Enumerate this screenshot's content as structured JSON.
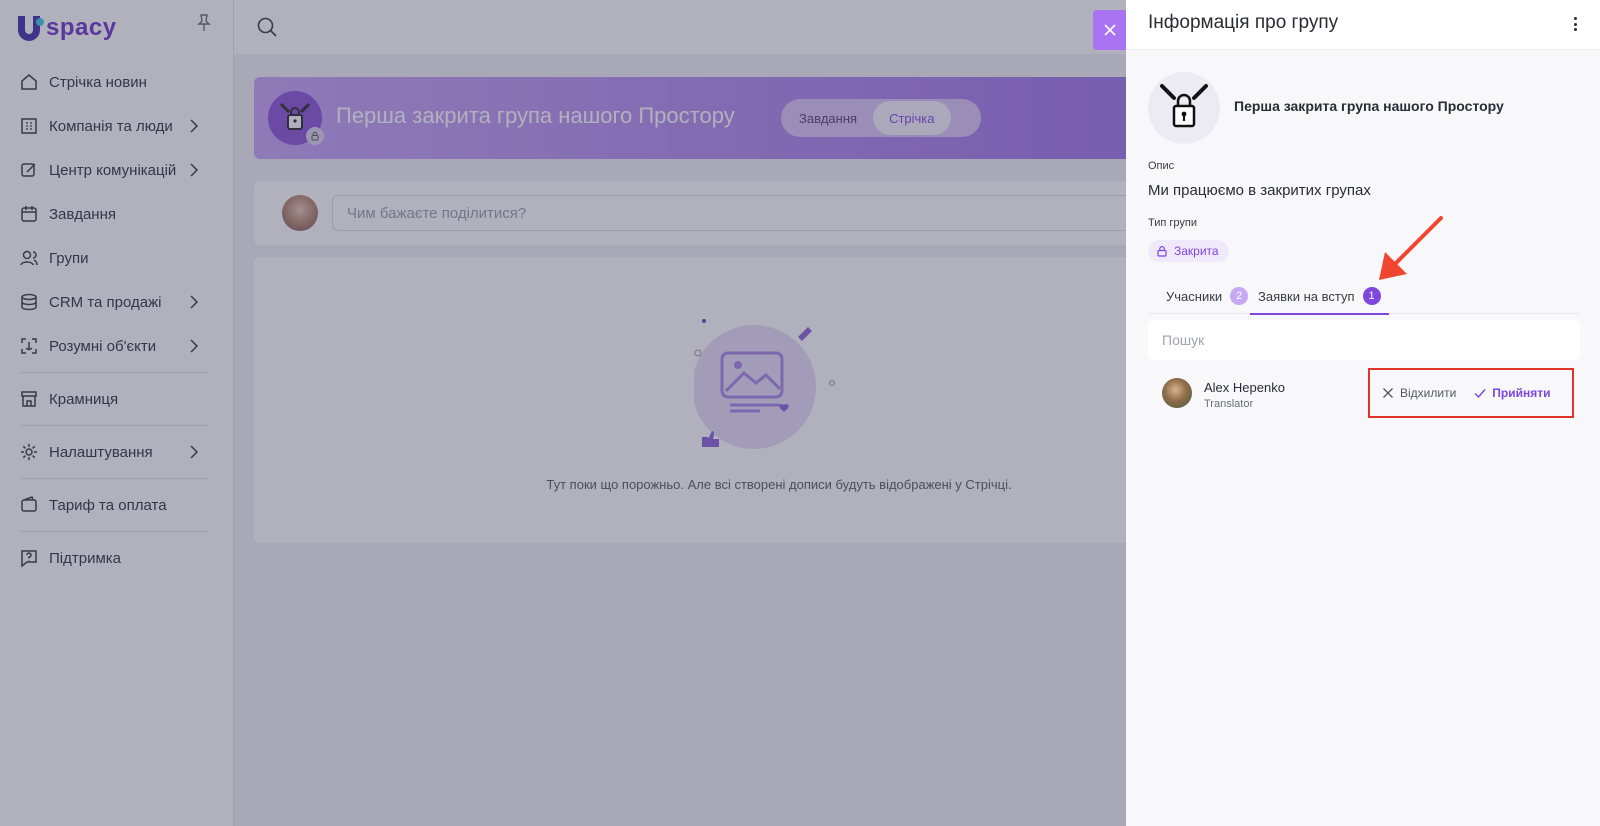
{
  "logo": {
    "text": "spacy",
    "letter": "U"
  },
  "sidebar": {
    "items": [
      {
        "label": "Стрічка новин",
        "icon": "news-icon",
        "chevron": false
      },
      {
        "label": "Компанія та люди",
        "icon": "building-icon",
        "chevron": true
      },
      {
        "label": "Центр комунікацій",
        "icon": "communication-icon",
        "chevron": true
      },
      {
        "label": "Завдання",
        "icon": "calendar-icon",
        "chevron": false
      },
      {
        "label": "Групи",
        "icon": "users-icon",
        "chevron": false
      },
      {
        "label": "CRM та продажі",
        "icon": "coins-icon",
        "chevron": true
      },
      {
        "label": "Розумні об'єкти",
        "icon": "smart-object-icon",
        "chevron": true
      },
      {
        "label": "Крамниця",
        "icon": "store-icon",
        "chevron": false
      },
      {
        "label": "Налаштування",
        "icon": "gear-icon",
        "chevron": true
      },
      {
        "label": "Тариф та оплата",
        "icon": "wallet-icon",
        "chevron": false
      },
      {
        "label": "Підтримка",
        "icon": "help-icon",
        "chevron": false
      }
    ]
  },
  "banner": {
    "title": "Перша закрита група нашого Простору",
    "tabs": [
      {
        "label": "Завдання",
        "active": false
      },
      {
        "label": "Стрічка",
        "active": true
      }
    ]
  },
  "composer": {
    "placeholder": "Чим бажаєте поділитися?"
  },
  "feed": {
    "empty_text": "Тут поки що порожньо. Але всі створені дописи будуть відображені у Стрічці."
  },
  "panel": {
    "title": "Інформація про групу",
    "group_name": "Перша закрита група нашого Простору",
    "description_label": "Опис",
    "description": "Ми працюємо в закритих групах",
    "type_label": "Тип групи",
    "type_value": "Закрита",
    "tabs": {
      "members_label": "Учасники",
      "members_count": "2",
      "requests_label": "Заявки на вступ",
      "requests_count": "1"
    },
    "search_placeholder": "Пошук",
    "request": {
      "name": "Alex Hepenko",
      "role": "Translator",
      "reject_label": "Відхилити",
      "accept_label": "Прийняти"
    }
  },
  "colors": {
    "accent": "#8046e0",
    "highlight_box": "#e0332b",
    "arrow": "#f0452f"
  }
}
